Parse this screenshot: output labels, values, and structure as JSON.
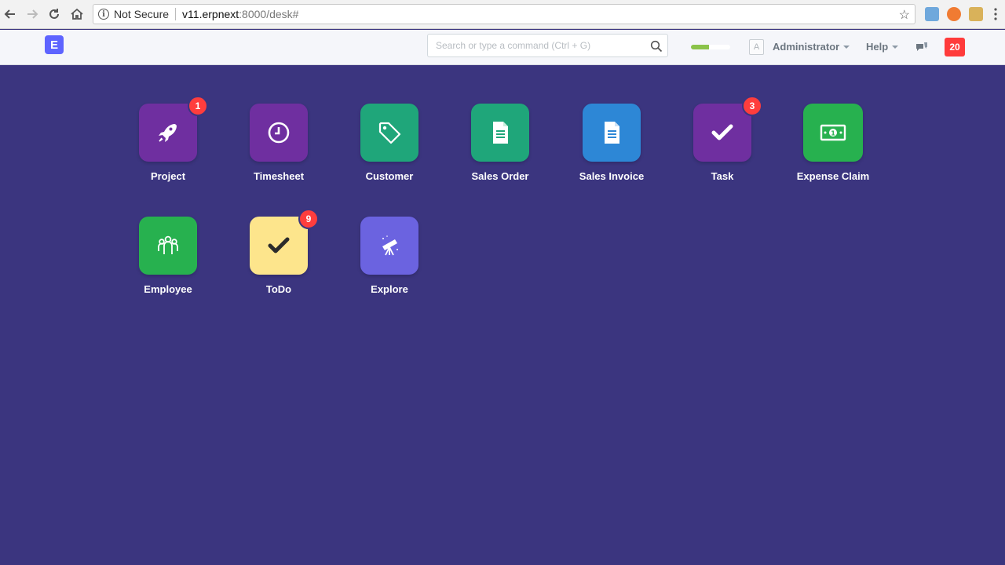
{
  "browser": {
    "security_label": "Not Secure",
    "url_host": "v11.erpnext",
    "url_path": ":8000/desk#"
  },
  "navbar": {
    "logo_letter": "E",
    "search_placeholder": "Search or type a command (Ctrl + G)",
    "progress": 0.45,
    "avatar_letter": "A",
    "user_label": "Administrator",
    "help_label": "Help",
    "notification_count": "20"
  },
  "colors": {
    "background": "#3b357f",
    "project": "#6f2fa0",
    "timesheet": "#6f2fa0",
    "customer": "#1fa67a",
    "sales_order": "#1fa67a",
    "sales_invoice": "#2d87d6",
    "task": "#6f2fa0",
    "expense_claim": "#27b14f",
    "employee": "#27b14f",
    "todo": "#fde58c",
    "explore": "#6b63e0",
    "badge": "#ff3d3d"
  },
  "modules": [
    {
      "label": "Project",
      "icon": "rocket-icon",
      "badge": "1"
    },
    {
      "label": "Timesheet",
      "icon": "clock-icon",
      "badge": ""
    },
    {
      "label": "Customer",
      "icon": "tag-icon",
      "badge": ""
    },
    {
      "label": "Sales Order",
      "icon": "document-icon",
      "badge": ""
    },
    {
      "label": "Sales Invoice",
      "icon": "document-icon",
      "badge": ""
    },
    {
      "label": "Task",
      "icon": "check-icon",
      "badge": "3"
    },
    {
      "label": "Expense Claim",
      "icon": "money-icon",
      "badge": ""
    },
    {
      "label": "Employee",
      "icon": "people-icon",
      "badge": ""
    },
    {
      "label": "ToDo",
      "icon": "check-icon",
      "badge": "9"
    },
    {
      "label": "Explore",
      "icon": "telescope-icon",
      "badge": ""
    }
  ]
}
